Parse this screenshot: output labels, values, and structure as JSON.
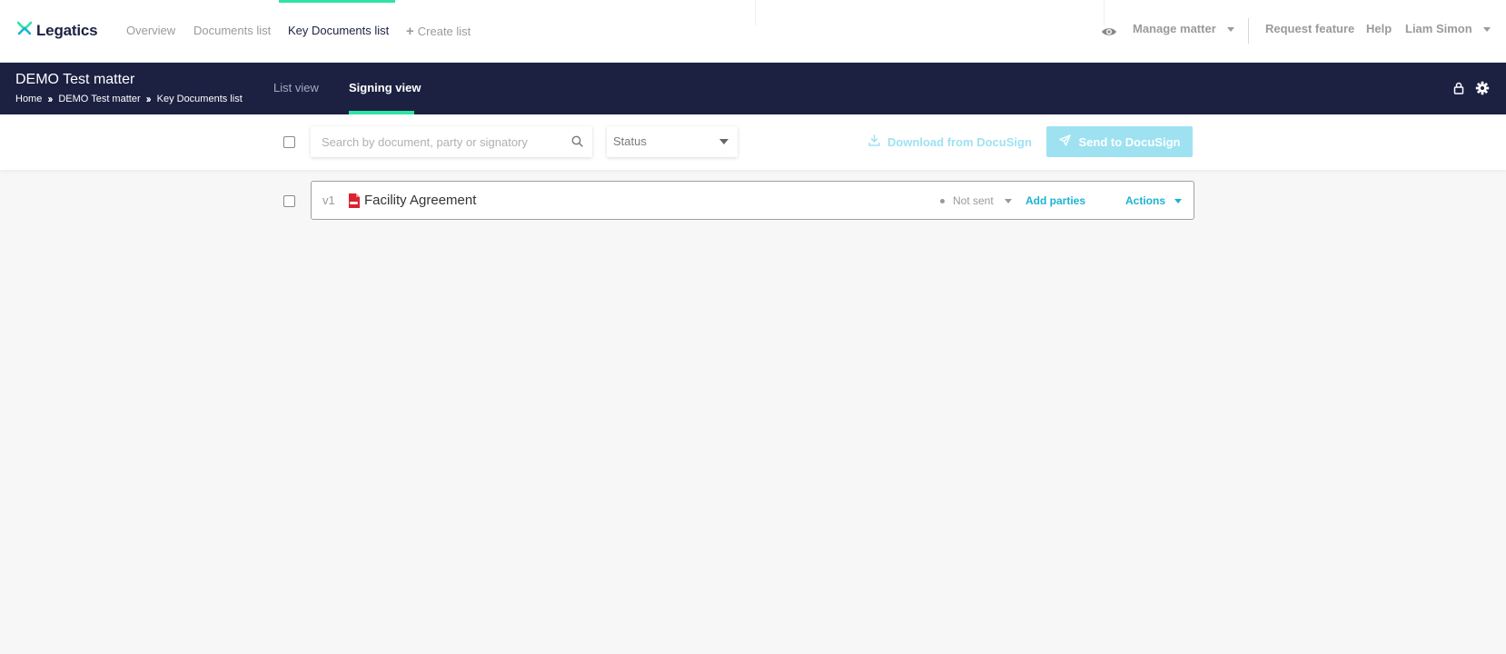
{
  "topnav": {
    "brand": "Legatics",
    "links": [
      {
        "label": "Overview"
      },
      {
        "label": "Documents list"
      },
      {
        "label": "Key Documents list"
      },
      {
        "label": "Create list"
      }
    ],
    "manage_matter": "Manage matter",
    "request_feature": "Request feature",
    "help": "Help",
    "user": "Liam Simon"
  },
  "matter": {
    "title": "DEMO Test matter",
    "breadcrumb": [
      "Home",
      "DEMO Test matter",
      "Key Documents list"
    ],
    "tabs": [
      {
        "label": "List view"
      },
      {
        "label": "Signing view"
      }
    ]
  },
  "toolbar": {
    "search_placeholder": "Search by document, party or signatory",
    "status_label": "Status",
    "download_label": "Download from DocuSign",
    "send_label": "Send to DocuSign"
  },
  "documents": [
    {
      "version": "v1",
      "name": "Facility Agreement",
      "status": "Not sent",
      "add_parties": "Add parties",
      "actions": "Actions"
    }
  ],
  "colors": {
    "brand_navy": "#1c2142",
    "accent_green": "#2ee3a4",
    "link_blue": "#1ab3d3",
    "disabled_blue": "#9ee2f2",
    "pdf_red": "#d9232e"
  },
  "icons": {
    "logo": "legatics-logo-icon",
    "view": "eye-icon",
    "lock": "lock-icon",
    "settings": "gear-icon",
    "search": "search-icon",
    "download": "download-icon",
    "send": "paper-plane-icon",
    "file": "pdf-file-icon"
  }
}
